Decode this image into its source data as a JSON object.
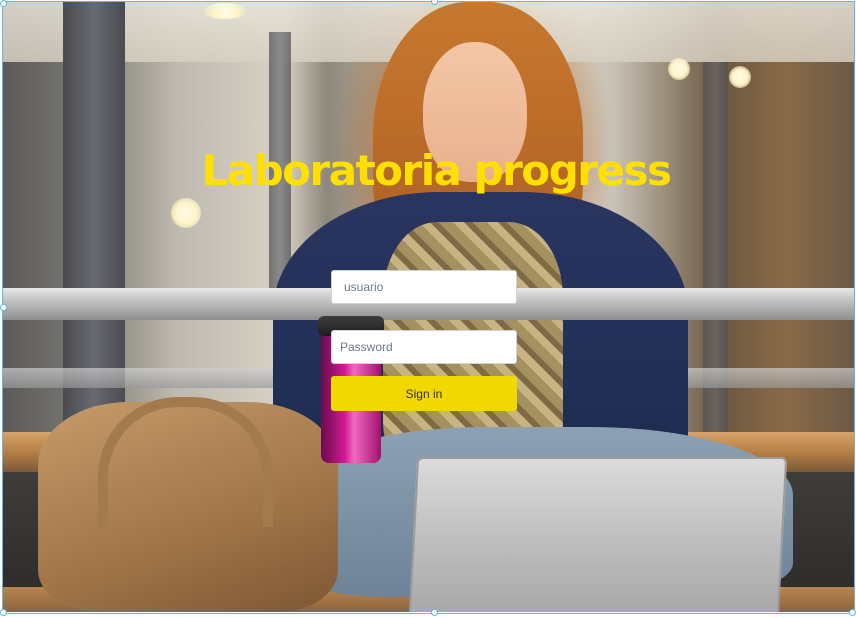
{
  "app": {
    "title": "Laboratoria progress"
  },
  "login": {
    "username_placeholder": "usuario",
    "username_value": "",
    "password_placeholder": "Password",
    "password_value": "",
    "signin_label": "Sign in"
  },
  "colors": {
    "title": "#ffe000",
    "button": "#f0d800",
    "selection": "#5fb8e8"
  }
}
